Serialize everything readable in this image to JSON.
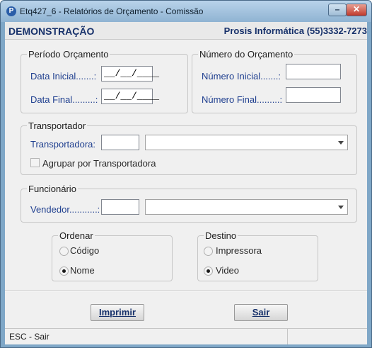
{
  "window": {
    "title": "Etq427_6 - Relatórios de Orçamento - Comissão",
    "minimize_glyph": "–",
    "close_glyph": "✕",
    "app_icon": "P"
  },
  "header": {
    "demo": "DEMONSTRAÇÃO",
    "company": "Prosis Informática (55)3332-7273"
  },
  "periodo": {
    "title": "Período Orçamento",
    "data_inicial_label": "Data Inicial.......:",
    "data_inicial_value": "__/__/____",
    "data_final_label": "Data Final.........:",
    "data_final_value": "__/__/____"
  },
  "numero": {
    "title": "Número do Orçamento",
    "inicial_label": "Número Inicial.......:",
    "inicial_value": "",
    "final_label": "Número Final.........:",
    "final_value": ""
  },
  "transportador": {
    "title": "Transportador",
    "label": "Transportadora:",
    "code": "",
    "name": "",
    "agrupar_label": "Agrupar por Transportadora",
    "agrupar_checked": false
  },
  "funcionario": {
    "title": "Funcionário",
    "label": "Vendedor...........:",
    "code": "",
    "name": ""
  },
  "ordenar": {
    "title": "Ordenar",
    "options": [
      "Código",
      "Nome"
    ],
    "selected": "Nome"
  },
  "destino": {
    "title": "Destino",
    "options": [
      "Impressora",
      "Video"
    ],
    "selected": "Video"
  },
  "buttons": {
    "imprimir": "Imprimir",
    "sair": "Sair"
  },
  "status": {
    "text": "ESC - Sair"
  }
}
